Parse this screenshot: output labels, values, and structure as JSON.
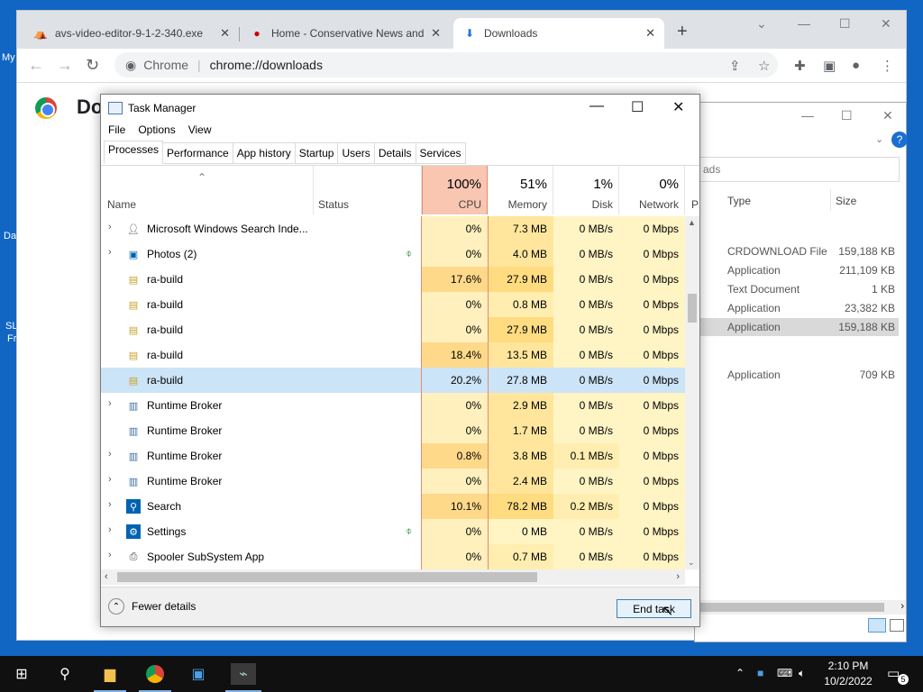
{
  "desktop": {
    "frag1": "My",
    "frag2": "Da",
    "frag3": "SL",
    "frag4": "Fr"
  },
  "browser": {
    "tabs": [
      {
        "title": "avs-video-editor-9-1-2-340.exe",
        "close": "✕"
      },
      {
        "title": "Home - Conservative News and",
        "close": "✕"
      },
      {
        "title": "Downloads",
        "close": "✕"
      }
    ],
    "new_tab": "+",
    "site_label": "Chrome",
    "url": "chrome://downloads",
    "page_title": "Do"
  },
  "explorer": {
    "search_placeholder": "ads",
    "col_type": "Type",
    "col_size": "Size",
    "rows": [
      {
        "type": "CRDOWNLOAD File",
        "size": "159,188 KB"
      },
      {
        "type": "Application",
        "size": "211,109 KB"
      },
      {
        "type": "Text Document",
        "size": "1 KB"
      },
      {
        "type": "Application",
        "size": "23,382 KB"
      },
      {
        "type": "Application",
        "size": "159,188 KB"
      },
      {
        "type": "Application",
        "size": "709 KB"
      }
    ]
  },
  "taskmanager": {
    "title": "Task Manager",
    "menu": [
      "File",
      "Options",
      "View"
    ],
    "tabs": [
      "Processes",
      "Performance",
      "App history",
      "Startup",
      "Users",
      "Details",
      "Services"
    ],
    "columns": {
      "name": "Name",
      "status": "Status",
      "cpu_pct": "100%",
      "cpu": "CPU",
      "mem_pct": "51%",
      "mem": "Memory",
      "disk_pct": "1%",
      "disk": "Disk",
      "net_pct": "0%",
      "net": "Network",
      "power": "P"
    },
    "processes": [
      {
        "name": "Microsoft Windows Search Inde...",
        "expand": true,
        "icon": "search-indexer-icon",
        "leaf": false,
        "cpu": "0%",
        "mem": "7.3 MB",
        "disk": "0 MB/s",
        "net": "0 Mbps"
      },
      {
        "name": "Photos (2)",
        "expand": true,
        "icon": "photos-icon",
        "leaf": true,
        "cpu": "0%",
        "mem": "4.0 MB",
        "disk": "0 MB/s",
        "net": "0 Mbps"
      },
      {
        "name": "ra-build",
        "expand": false,
        "icon": "installer-icon",
        "leaf": false,
        "cpu": "17.6%",
        "mem": "27.9 MB",
        "disk": "0 MB/s",
        "net": "0 Mbps"
      },
      {
        "name": "ra-build",
        "expand": false,
        "icon": "installer-icon",
        "leaf": false,
        "cpu": "0%",
        "mem": "0.8 MB",
        "disk": "0 MB/s",
        "net": "0 Mbps"
      },
      {
        "name": "ra-build",
        "expand": false,
        "icon": "installer-icon",
        "leaf": false,
        "cpu": "0%",
        "mem": "27.9 MB",
        "disk": "0 MB/s",
        "net": "0 Mbps"
      },
      {
        "name": "ra-build",
        "expand": false,
        "icon": "installer-icon",
        "leaf": false,
        "cpu": "18.4%",
        "mem": "13.5 MB",
        "disk": "0 MB/s",
        "net": "0 Mbps"
      },
      {
        "name": "ra-build",
        "expand": false,
        "icon": "installer-icon",
        "leaf": false,
        "cpu": "20.2%",
        "mem": "27.8 MB",
        "disk": "0 MB/s",
        "net": "0 Mbps",
        "selected": true
      },
      {
        "name": "Runtime Broker",
        "expand": true,
        "icon": "runtime-broker-icon",
        "leaf": false,
        "cpu": "0%",
        "mem": "2.9 MB",
        "disk": "0 MB/s",
        "net": "0 Mbps"
      },
      {
        "name": "Runtime Broker",
        "expand": false,
        "icon": "runtime-broker-icon",
        "leaf": false,
        "cpu": "0%",
        "mem": "1.7 MB",
        "disk": "0 MB/s",
        "net": "0 Mbps"
      },
      {
        "name": "Runtime Broker",
        "expand": true,
        "icon": "runtime-broker-icon",
        "leaf": false,
        "cpu": "0.8%",
        "mem": "3.8 MB",
        "disk": "0.1 MB/s",
        "net": "0 Mbps"
      },
      {
        "name": "Runtime Broker",
        "expand": true,
        "icon": "runtime-broker-icon",
        "leaf": false,
        "cpu": "0%",
        "mem": "2.4 MB",
        "disk": "0 MB/s",
        "net": "0 Mbps"
      },
      {
        "name": "Search",
        "expand": true,
        "icon": "search-icon",
        "leaf": false,
        "cpu": "10.1%",
        "mem": "78.2 MB",
        "disk": "0.2 MB/s",
        "net": "0 Mbps"
      },
      {
        "name": "Settings",
        "expand": true,
        "icon": "settings-gear-icon",
        "leaf": true,
        "cpu": "0%",
        "mem": "0 MB",
        "disk": "0 MB/s",
        "net": "0 Mbps"
      },
      {
        "name": "Spooler SubSystem App",
        "expand": true,
        "icon": "printer-icon",
        "leaf": false,
        "cpu": "0%",
        "mem": "0.7 MB",
        "disk": "0 MB/s",
        "net": "0 Mbps"
      }
    ],
    "fewer_details": "Fewer details",
    "end_task": "End task"
  },
  "taskbar": {
    "time": "2:10 PM",
    "date": "10/2/2022",
    "notification_count": "5"
  }
}
